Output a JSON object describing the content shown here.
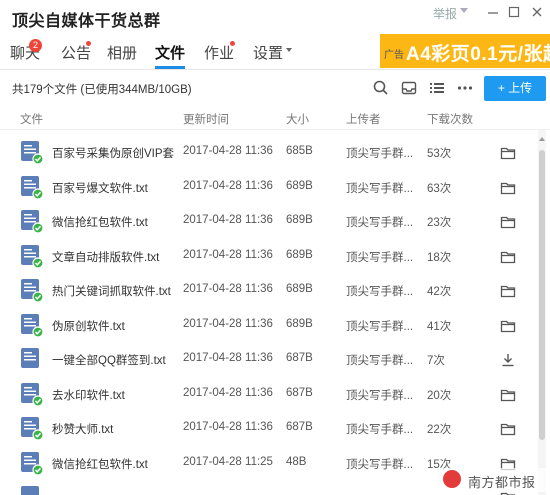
{
  "window": {
    "title": "顶尖自媒体干货总群",
    "report_label": "举报"
  },
  "nav": {
    "tabs": [
      {
        "label": "聊天",
        "badge": "2"
      },
      {
        "label": "公告"
      },
      {
        "label": "相册"
      },
      {
        "label": "文件"
      },
      {
        "label": "作业"
      },
      {
        "label": "设置"
      }
    ],
    "active_tab": "文件"
  },
  "ad": {
    "tag": "广告",
    "text": "A4彩页0.1元/张起"
  },
  "toolbar": {
    "file_count": "共179个文件 (已使用344MB/10GB)",
    "upload_label": "+ 上传"
  },
  "table": {
    "columns": [
      "文件",
      "更新时间",
      "大小",
      "上传者",
      "下载次数"
    ],
    "rows": [
      {
        "name": "百家号采集伪原创VIP套...",
        "time": "2017-04-28 11:36",
        "size": "685B",
        "uploader": "顶尖写手群...",
        "count": "53次",
        "action": "folder"
      },
      {
        "name": "百家号爆文软件.txt",
        "time": "2017-04-28 11:36",
        "size": "689B",
        "uploader": "顶尖写手群...",
        "count": "63次",
        "action": "folder"
      },
      {
        "name": "微信抢红包软件.txt",
        "time": "2017-04-28 11:36",
        "size": "689B",
        "uploader": "顶尖写手群...",
        "count": "23次",
        "action": "folder"
      },
      {
        "name": "文章自动排版软件.txt",
        "time": "2017-04-28 11:36",
        "size": "689B",
        "uploader": "顶尖写手群...",
        "count": "18次",
        "action": "folder"
      },
      {
        "name": "热门关键词抓取软件.txt",
        "time": "2017-04-28 11:36",
        "size": "689B",
        "uploader": "顶尖写手群...",
        "count": "42次",
        "action": "folder"
      },
      {
        "name": "伪原创软件.txt",
        "time": "2017-04-28 11:36",
        "size": "689B",
        "uploader": "顶尖写手群...",
        "count": "41次",
        "action": "folder"
      },
      {
        "name": "一键全部QQ群签到.txt",
        "time": "2017-04-28 11:36",
        "size": "687B",
        "uploader": "顶尖写手群...",
        "count": "7次",
        "action": "download"
      },
      {
        "name": "去水印软件.txt",
        "time": "2017-04-28 11:36",
        "size": "687B",
        "uploader": "顶尖写手群...",
        "count": "20次",
        "action": "folder"
      },
      {
        "name": "秒赞大师.txt",
        "time": "2017-04-28 11:36",
        "size": "687B",
        "uploader": "顶尖写手群...",
        "count": "22次",
        "action": "folder"
      },
      {
        "name": "微信抢红包软件.txt",
        "time": "2017-04-28 11:25",
        "size": "48B",
        "uploader": "顶尖写手群...",
        "count": "15次",
        "action": "folder"
      },
      {
        "name": "",
        "time": "",
        "size": "",
        "uploader": "",
        "count": "",
        "action": "folder"
      }
    ]
  },
  "watermark": {
    "text": "南方都市报"
  },
  "colors": {
    "accent": "#1e8ce6",
    "upload_button": "#1e9bf0",
    "badge": "#f0453a",
    "ad_background": "#fdb715",
    "file_icon": "#5b7db8",
    "check_badge": "#3cb34a"
  }
}
